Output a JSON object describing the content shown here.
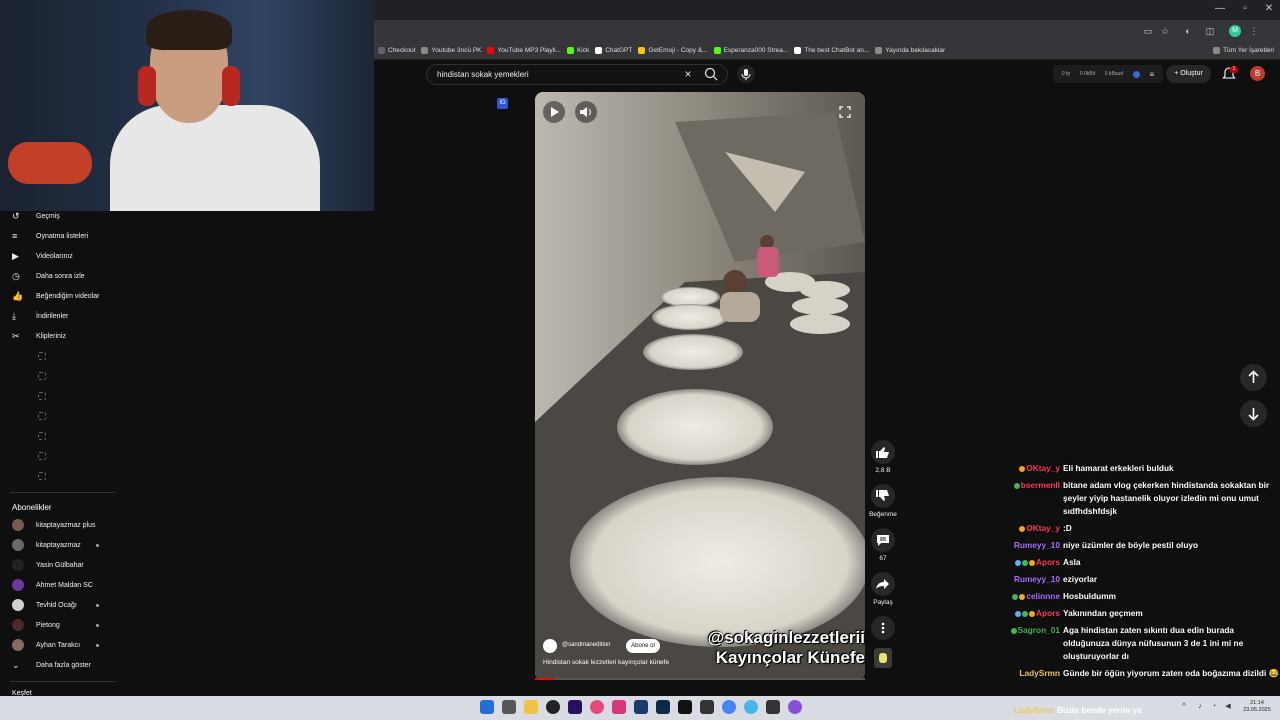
{
  "browser": {
    "window_controls": [
      "—",
      "▫",
      "✕"
    ],
    "bookmarks": [
      {
        "label": "Checkout",
        "color": "#5f6368"
      },
      {
        "label": "Youtube 3ncü PK",
        "color": "#8a8a8a"
      },
      {
        "label": "YouTube MP3 Playli...",
        "color": "#ff0000"
      },
      {
        "label": "Kick",
        "color": "#53fc18"
      },
      {
        "label": "ChatGPT",
        "color": "#ffffff"
      },
      {
        "label": "GetEmoji - Copy &...",
        "color": "#f9c80e"
      },
      {
        "label": "Esperanza000 Strea...",
        "color": "#53fc18"
      },
      {
        "label": "The best ChatBot an...",
        "color": "#ffffff"
      },
      {
        "label": "Yayında bakılacaklar",
        "color": "#8a8a8a"
      }
    ],
    "all_bookmarks": "Tüm Yer İşaretleri"
  },
  "header": {
    "search_value": "hindistan sokak yemekleri",
    "stats": [
      "0 fp",
      "0 0kBit",
      "0 kBaud"
    ],
    "create_label": "Oluştur",
    "notif_count": "1",
    "avatar_letter": "B",
    "logo_badge": "IG"
  },
  "sidebar": {
    "items": [
      {
        "label": "Geçmiş",
        "icon": "history-icon"
      },
      {
        "label": "Oynatma listeleri",
        "icon": "playlist-icon"
      },
      {
        "label": "Videolarınız",
        "icon": "video-icon"
      },
      {
        "label": "Daha sonra izle",
        "icon": "clock-icon"
      },
      {
        "label": "Beğendiğim videolar",
        "icon": "like-icon"
      },
      {
        "label": "İndirilenler",
        "icon": "download-icon"
      },
      {
        "label": "Klipleriniz",
        "icon": "scissors-icon"
      }
    ],
    "subs_heading": "Abonelikler",
    "subs": [
      {
        "label": "kitaptayazmaz plus",
        "color": "#7a5a4a",
        "dot": false
      },
      {
        "label": "kitaptayazmaz",
        "color": "#6a6a6a",
        "dot": true
      },
      {
        "label": "Yasin Gülbahar",
        "color": "#222222",
        "dot": false
      },
      {
        "label": "Ahmet Maldan SC",
        "color": "#6a3aa0",
        "dot": false
      },
      {
        "label": "Tevhid Ocağı",
        "color": "#d0d0d0",
        "dot": true
      },
      {
        "label": "Pietong",
        "color": "#4a2a2a",
        "dot": true
      },
      {
        "label": "Ayhan Tarakcı",
        "color": "#8a6a5a",
        "dot": true
      }
    ],
    "show_more": "Daha fazla göster",
    "explore": "Keşfet"
  },
  "video": {
    "channel": "@sandmanedition",
    "subscribe": "Abone ol",
    "title": "Hindistan sokak lezzetleri kayınçolar künefe",
    "overlay_line1": "@sokaginlezzetlerii",
    "overlay_line2": "Kayınçolar Künefe",
    "progress": 0.06
  },
  "actions": {
    "likes": "2,8 B",
    "dislike": "Beğenme",
    "comments": "67",
    "share": "Paylaş"
  },
  "chat": [
    {
      "user": "OKtay_y",
      "color": "#ff3b57",
      "msg": "Eli hamarat erkekleri bulduk",
      "badges": [
        "#f5a623"
      ]
    },
    {
      "user": "bsermenll",
      "color": "#ff3b57",
      "msg": "bitane adam vlog çekerken hindistanda sokaktan bir şeyler yiyip hastanelik oluyor izledin mi onu umut sıdfhdshfdsjk",
      "badges": [
        "#3fb950"
      ]
    },
    {
      "user": "OKtay_y",
      "color": "#ff3b57",
      "msg": ":D",
      "badges": [
        "#f5a623"
      ]
    },
    {
      "user": "Rumeyy_10",
      "color": "#a970ff",
      "msg": "niye üzümler de böyle pestil oluyo",
      "badges": []
    },
    {
      "user": "Apors",
      "color": "#ff3b57",
      "msg": "Asla",
      "badges": [
        "#5ab0ff",
        "#3fb950",
        "#f5a623"
      ]
    },
    {
      "user": "Rumeyy_10",
      "color": "#a970ff",
      "msg": "eziyorlar",
      "badges": []
    },
    {
      "user": "celinnne",
      "color": "#a970ff",
      "msg": "Hosbuldumm",
      "badges": [
        "#3fb950",
        "#f5a623"
      ]
    },
    {
      "user": "Apors",
      "color": "#ff3b57",
      "msg": "Yakınından geçmem",
      "badges": [
        "#5ab0ff",
        "#3fb950",
        "#f5a623"
      ]
    },
    {
      "user": "Sagron_01",
      "color": "#3fb950",
      "msg": "Aga hindistan zaten sıkıntı dua edin burada olduğunuza dünya nüfusunun 3 de 1 ini mi ne oluşturuyorlar dı",
      "badges": [
        "#3fb950"
      ]
    },
    {
      "user": "LadySrmn",
      "color": "#f5c84c",
      "msg": "Günde bir öğün yiyorum zaten oda boğazıma dizildi 😂",
      "badges": []
    }
  ],
  "last_chat": {
    "user": "LadySrmn",
    "color": "#f5c84c",
    "msg": "Bizde bende yerim ya"
  },
  "taskbar": {
    "time": "21:14",
    "date": "23.05.2025"
  }
}
